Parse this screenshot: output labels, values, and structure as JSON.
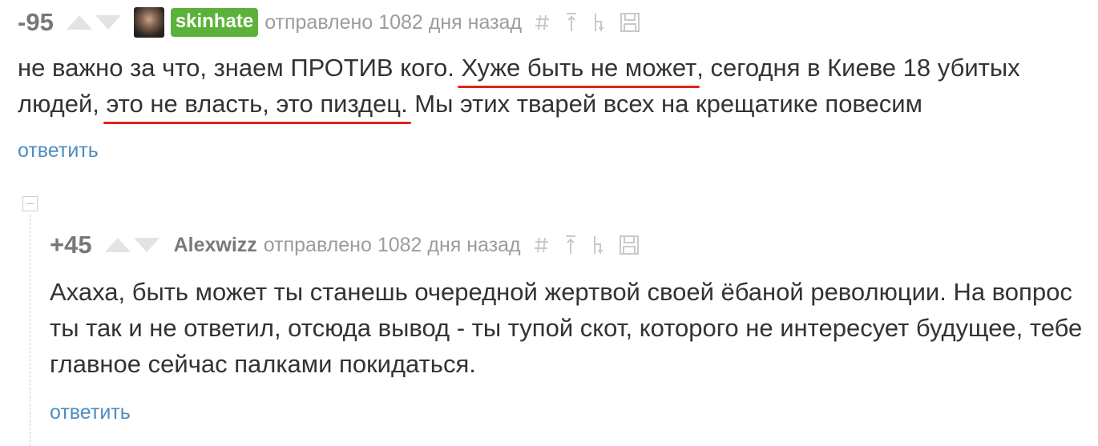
{
  "comments": [
    {
      "score": "-95",
      "username": "skinhate",
      "meta_prefix": "отправлено ",
      "meta_count": "1082",
      "meta_suffix": " дня назад",
      "icons": [
        "hash-icon",
        "arrow-up-line-icon",
        "branch-icon",
        "save-icon"
      ],
      "body": {
        "p1": "не важно за что, знаем ПРОТИВ кого. ",
        "u1": "Хуже быть не может",
        "p2": ", сегодня в Киеве 18 убитых людей, ",
        "u2": "это не власть, это пиздец.",
        "p3": " Мы этих тварей всех на крещатике повесим"
      },
      "reply_label": "ответить"
    },
    {
      "score": "+45",
      "username": "Alexwizz",
      "meta_prefix": "отправлено ",
      "meta_count": "1082",
      "meta_suffix": " дня назад",
      "icons": [
        "hash-icon",
        "arrow-up-line-icon",
        "branch-icon",
        "save-icon"
      ],
      "body": "Ахаха, быть может ты станешь очередной жертвой своей ёбаной революции. На вопрос ты так и не ответил, отсюда вывод - ты тупой скот, которого не интересует будущее, тебе главное сейчас палками покидаться.",
      "reply_label": "ответить"
    }
  ],
  "colors": {
    "badge": "#5bb23a",
    "link": "#4d8cc2",
    "underline": "#e3231a",
    "meta": "#9c9c9c"
  }
}
